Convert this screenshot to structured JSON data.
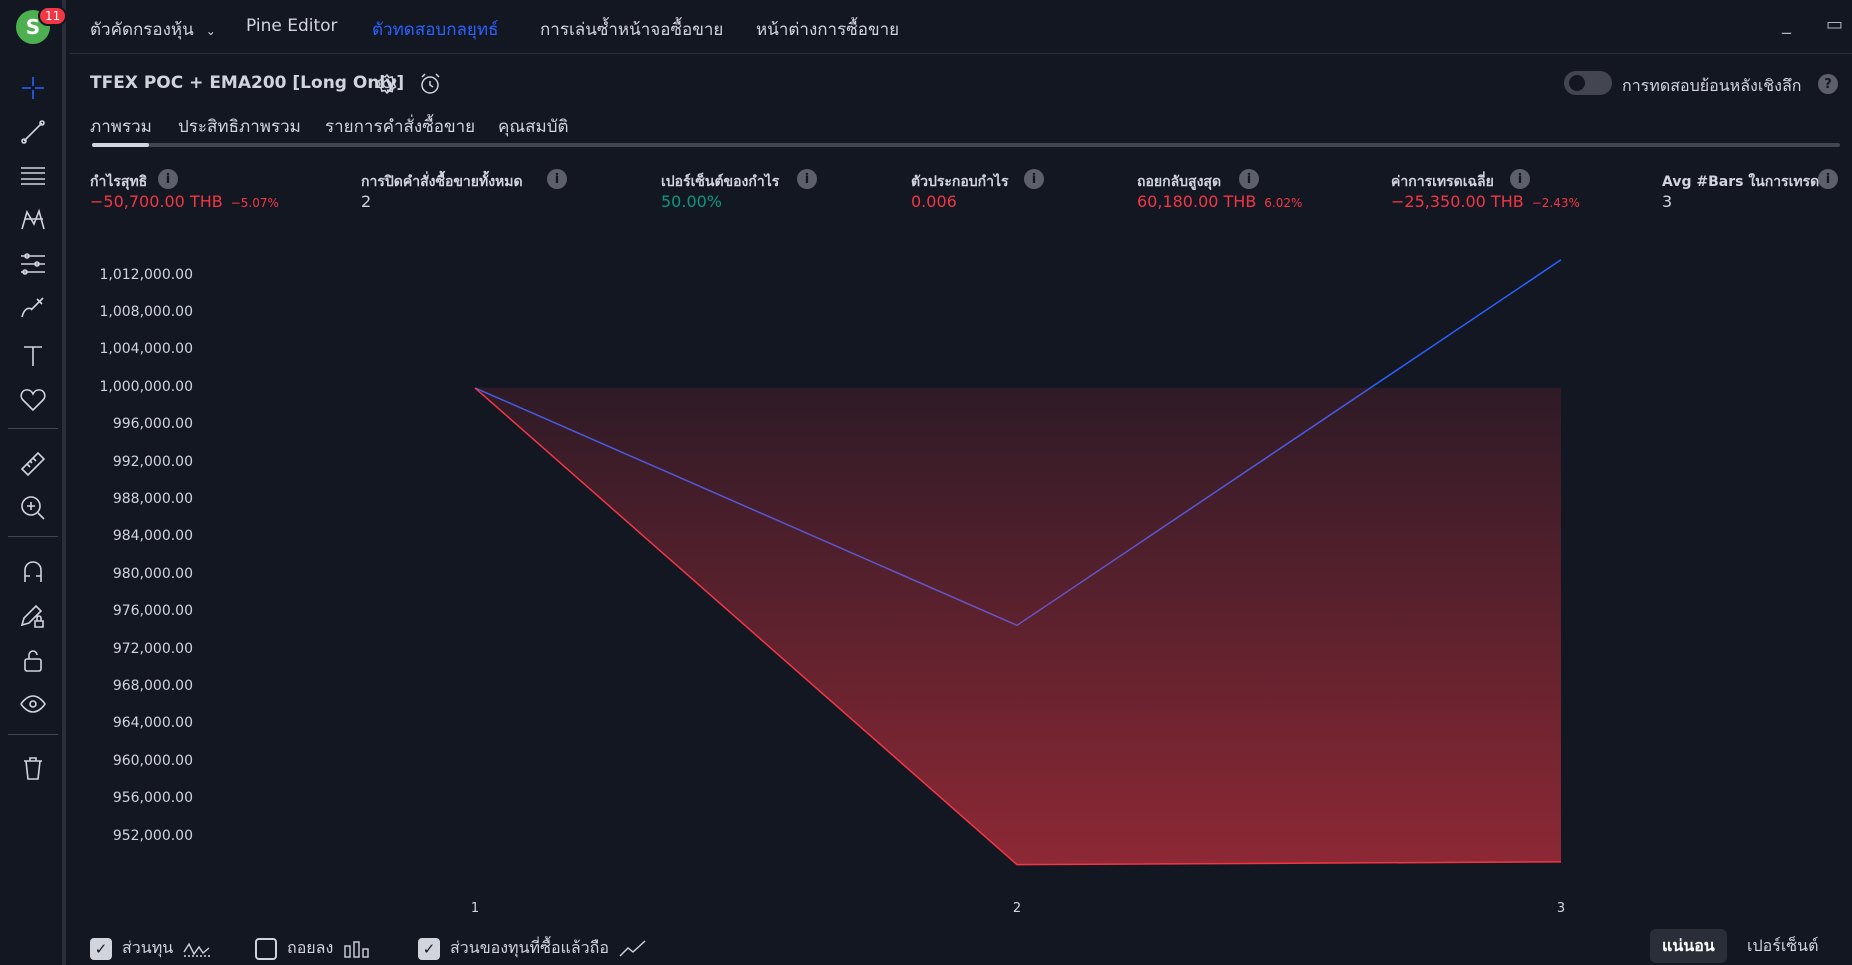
{
  "avatar": {
    "initial": "S",
    "badge": "11"
  },
  "topnav": {
    "items": [
      "ตัวคัดกรองหุ้น",
      "Pine Editor",
      "ตัวทดสอบกลยุทธ์",
      "การเล่นซ้ำหน้าจอซื้อขาย",
      "หน้าต่างการซื้อขาย"
    ],
    "active_index": 2
  },
  "strategy": {
    "title": "TFEX POC + EMA200 [Long Only]",
    "deep_backtest_label": "การทดสอบย้อนหลังเชิงลึก",
    "deep_backtest_enabled": false
  },
  "tabs": [
    "ภาพรวม",
    "ประสิทธิภาพรวม",
    "รายการคำสั่งซื้อขาย",
    "คุณสมบัติ"
  ],
  "metrics": [
    {
      "label": "กำไรสุทธิ",
      "value": "−50,700.00 THB",
      "sub": "−5.07%",
      "tone": "neg"
    },
    {
      "label": "การปิดคำสั่งซื้อขายทั้งหมด",
      "value": "2",
      "sub": "",
      "tone": "neutral"
    },
    {
      "label": "เปอร์เซ็นต์ของกำไร",
      "value": "50.00%",
      "sub": "",
      "tone": "pos"
    },
    {
      "label": "ตัวประกอบกำไร",
      "value": "0.006",
      "sub": "",
      "tone": "neg"
    },
    {
      "label": "ถอยกลับสูงสุด",
      "value": "60,180.00 THB",
      "sub": "6.02%",
      "tone": "neg"
    },
    {
      "label": "ค่าการเทรดเฉลี่ย",
      "value": "−25,350.00 THB",
      "sub": "−2.43%",
      "tone": "neg"
    },
    {
      "label": "Avg #Bars ในการเทรด",
      "value": "3",
      "sub": "",
      "tone": "neutral"
    }
  ],
  "chart_data": {
    "type": "line",
    "x": [
      1,
      2,
      3
    ],
    "ylim": [
      948000,
      1014000
    ],
    "y_ticks": [
      "1,012,000.00",
      "1,008,000.00",
      "1,004,000.00",
      "1,000,000.00",
      "996,000.00",
      "992,000.00",
      "988,000.00",
      "984,000.00",
      "980,000.00",
      "976,000.00",
      "972,000.00",
      "968,000.00",
      "964,000.00",
      "960,000.00",
      "956,000.00",
      "952,000.00"
    ],
    "y_tick_values": [
      1012000,
      1008000,
      1004000,
      1000000,
      996000,
      992000,
      988000,
      984000,
      980000,
      976000,
      972000,
      968000,
      964000,
      960000,
      956000,
      952000
    ],
    "x_ticks": [
      "1",
      "2",
      "3"
    ],
    "series": [
      {
        "name": "ส่วนของทุนที่ซื้อแล้วถือ",
        "values": [
          1000000,
          974600,
          1013700
        ],
        "color": "#2962ff"
      },
      {
        "name": "ส่วนทุน",
        "values": [
          1000000,
          949000,
          949300
        ],
        "color": "#f23645",
        "fill_to": 1000000
      }
    ],
    "grid": false
  },
  "legend": {
    "items": [
      {
        "label": "ส่วนทุน",
        "checked": true,
        "icon": "equity-icon"
      },
      {
        "label": "ถอยลง",
        "checked": false,
        "icon": "drawdown-icon"
      },
      {
        "label": "ส่วนของทุนที่ซื้อแล้วถือ",
        "checked": true,
        "icon": "buy-hold-icon"
      }
    ],
    "mode_absolute": "แน่นอน",
    "mode_percent": "เปอร์เซ็นต์"
  },
  "colors": {
    "accent": "#2962ff",
    "negative": "#f23645",
    "positive": "#089981"
  }
}
